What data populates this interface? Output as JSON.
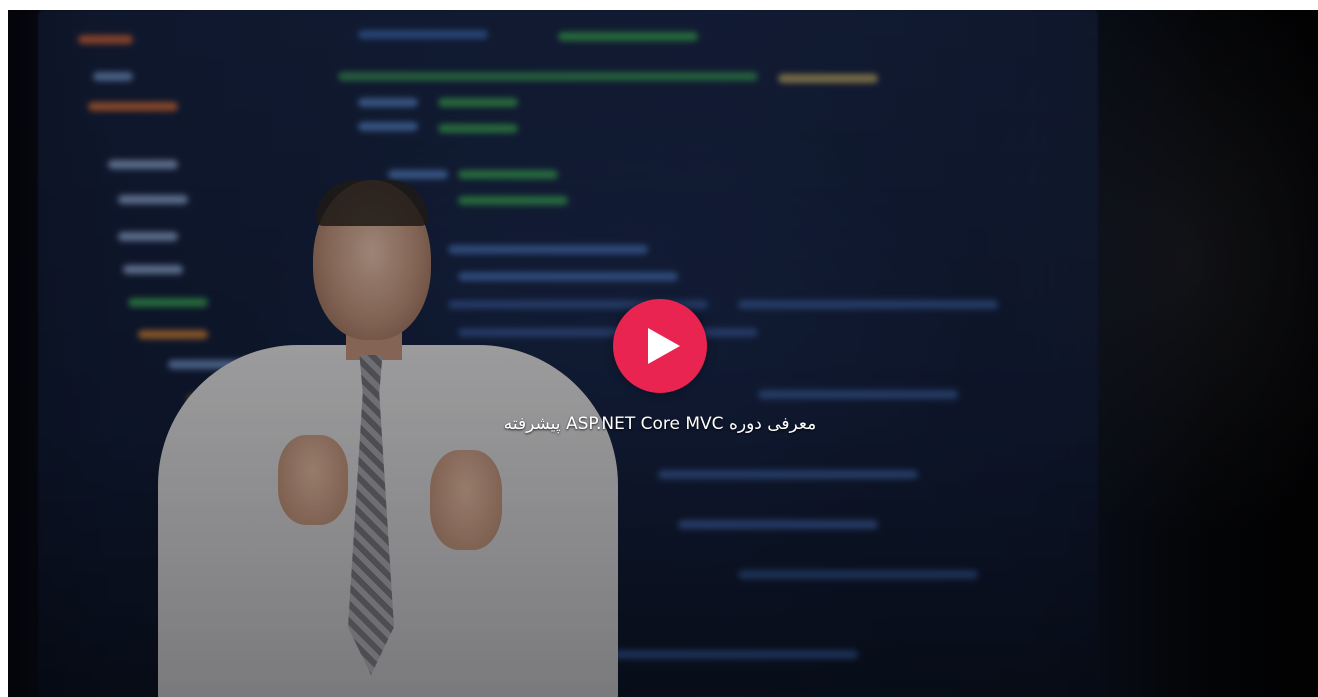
{
  "video": {
    "title": "معرفی دوره ASP.NET Core MVC پیشرفته",
    "play_icon": "play-icon",
    "accent_color": "#ea2451"
  }
}
